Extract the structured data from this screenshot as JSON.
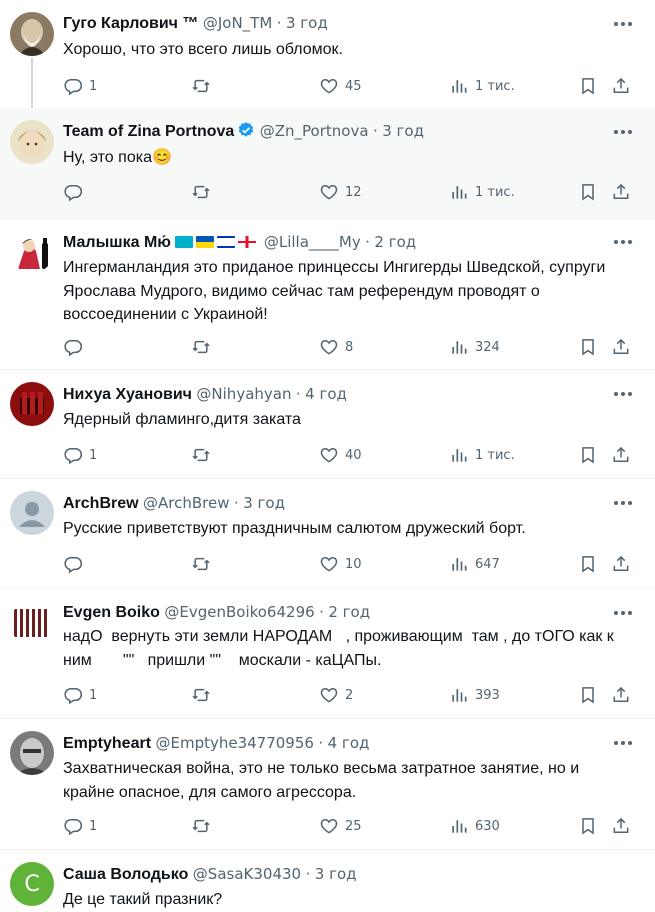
{
  "tweets": [
    {
      "name": "Гуго Карлович ™",
      "handle": "@JoN_TM",
      "time": "3 год",
      "text": "Хорошо, что это всего лишь обломок.",
      "replies": "1",
      "retweets": "",
      "likes": "45",
      "views": "1 тис."
    },
    {
      "name": "Team of Zina Portnova",
      "handle": "@Zn_Portnova",
      "time": "3 год",
      "text": "Ну, это пока😊",
      "replies": "",
      "retweets": "",
      "likes": "12",
      "views": "1 тис.",
      "verified": true
    },
    {
      "name": "Малышка Мю́",
      "handle": "@Lilla____My",
      "time": "2 год",
      "text": "Ингерманландия это приданое принцессы Ингигерды Шведской, супруги Ярослава Мудрого, видимо сейчас там референдум проводят о воссоединении с Украиной!",
      "replies": "",
      "retweets": "",
      "likes": "8",
      "views": "324"
    },
    {
      "name": "Нихуа Хуанович",
      "handle": "@Nihyahyan",
      "time": "4 год",
      "text": "Ядерный фламинго,дитя заката",
      "replies": "1",
      "retweets": "",
      "likes": "40",
      "views": "1 тис."
    },
    {
      "name": "ArchBrew",
      "handle": "@ArchBrew",
      "time": "3 год",
      "text": "Русские приветствуют праздничным салютом дружеский борт.",
      "replies": "",
      "retweets": "",
      "likes": "10",
      "views": "647"
    },
    {
      "name": "Evgen Boiko",
      "handle": "@EvgenBoiko64296",
      "time": "2 год",
      "text": "надО  вернуть эти земли НАРОДАМ   , проживающим  там , до тОГО как к ним       \"\"   пришли \"\"    москали - каЦАПы.",
      "replies": "1",
      "retweets": "",
      "likes": "2",
      "views": "393"
    },
    {
      "name": "Emptyheart",
      "handle": "@Emptyhe34770956",
      "time": "4 год",
      "text": "Захватническая война, это не только весьма затратное занятие, но и крайне опасное, для самого агрессора.",
      "replies": "1",
      "retweets": "",
      "likes": "25",
      "views": "630"
    },
    {
      "name": "Саша Володько",
      "handle": "@SasaK30430",
      "time": "3 год",
      "text": "Де це такий празник?",
      "replies": "",
      "retweets": "",
      "likes": "",
      "views": "",
      "avatar_letter": "С"
    }
  ],
  "separator": "·",
  "colors": {
    "muted": "#536471",
    "text": "#0f1419",
    "verified": "#1d9bf0",
    "avatar_green": "#5fb339"
  }
}
